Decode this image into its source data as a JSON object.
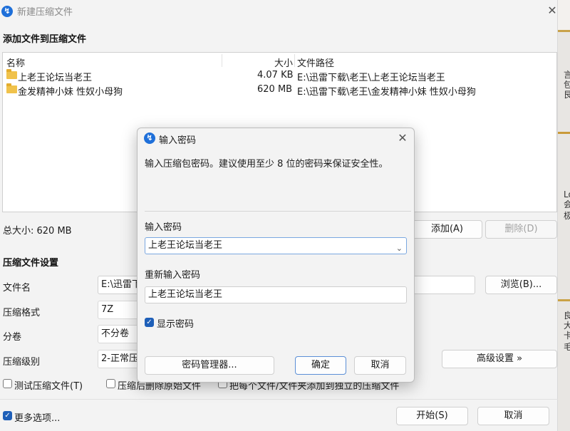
{
  "main": {
    "title": "新建压缩文件",
    "close_glyph": "✕",
    "section_add": "添加文件到压缩文件",
    "list": {
      "headers": [
        "名称",
        "大小",
        "文件路径"
      ],
      "rows": [
        {
          "name": "上老王论坛当老王",
          "size": "4.07 KB",
          "path": "E:\\迅雷下载\\老王\\上老王论坛当老王"
        },
        {
          "name": "金发精神小妹 性奴小母狗",
          "size": "620 MB",
          "path": "E:\\迅雷下载\\老王\\金发精神小妹 性奴小母狗"
        }
      ]
    },
    "total_size": "总大小: 620 MB",
    "add_button": "添加(A)",
    "delete_button": "删除(D)",
    "section_settings": "压缩文件设置",
    "filename_label": "文件名",
    "filename_value": "E:\\迅雷下",
    "browse_button": "浏览(B)...",
    "format_label": "压缩格式",
    "format_value": "7Z",
    "volume_label": "分卷",
    "volume_value": "不分卷",
    "level_label": "压缩级别",
    "level_value": "2-正常压",
    "advanced_button": "高级设置 »",
    "test_checkbox": "测试压缩文件(T)",
    "delete_after_checkbox": "压缩后删除原始文件",
    "each_file_checkbox": "把每个文件/文件夹添加到独立的压缩文件",
    "more_options": "更多选项...",
    "start_button": "开始(S)",
    "cancel_button": "取消"
  },
  "dialog": {
    "title": "输入密码",
    "description": "输入压缩包密码。建议使用至少 8 位的密码来保证安全性。",
    "password_label": "输入密码",
    "password_value": "上老王论坛当老王",
    "reenter_label": "重新输入密码",
    "reenter_value": "上老王论坛当老王",
    "show_password": "显示密码",
    "show_password_checked": true,
    "manager_button": "密码管理器...",
    "ok_button": "确定",
    "cancel_button": "取消",
    "close_glyph": "✕"
  },
  "background": {
    "snippets": [
      "言",
      "包",
      "艮",
      "Lo",
      "会",
      "极",
      "良",
      "大",
      "卡",
      "毛"
    ]
  },
  "colors": {
    "accent": "#1e5fb8",
    "app_icon": "#1e6fd9",
    "folder": "#f0c24b",
    "window_bg": "#f3f3f3"
  },
  "icons": {
    "app": "bandizip-app-icon",
    "folder": "folder-icon",
    "checkbox": "checkmark-icon",
    "dropdown": "chevron-down-icon"
  }
}
